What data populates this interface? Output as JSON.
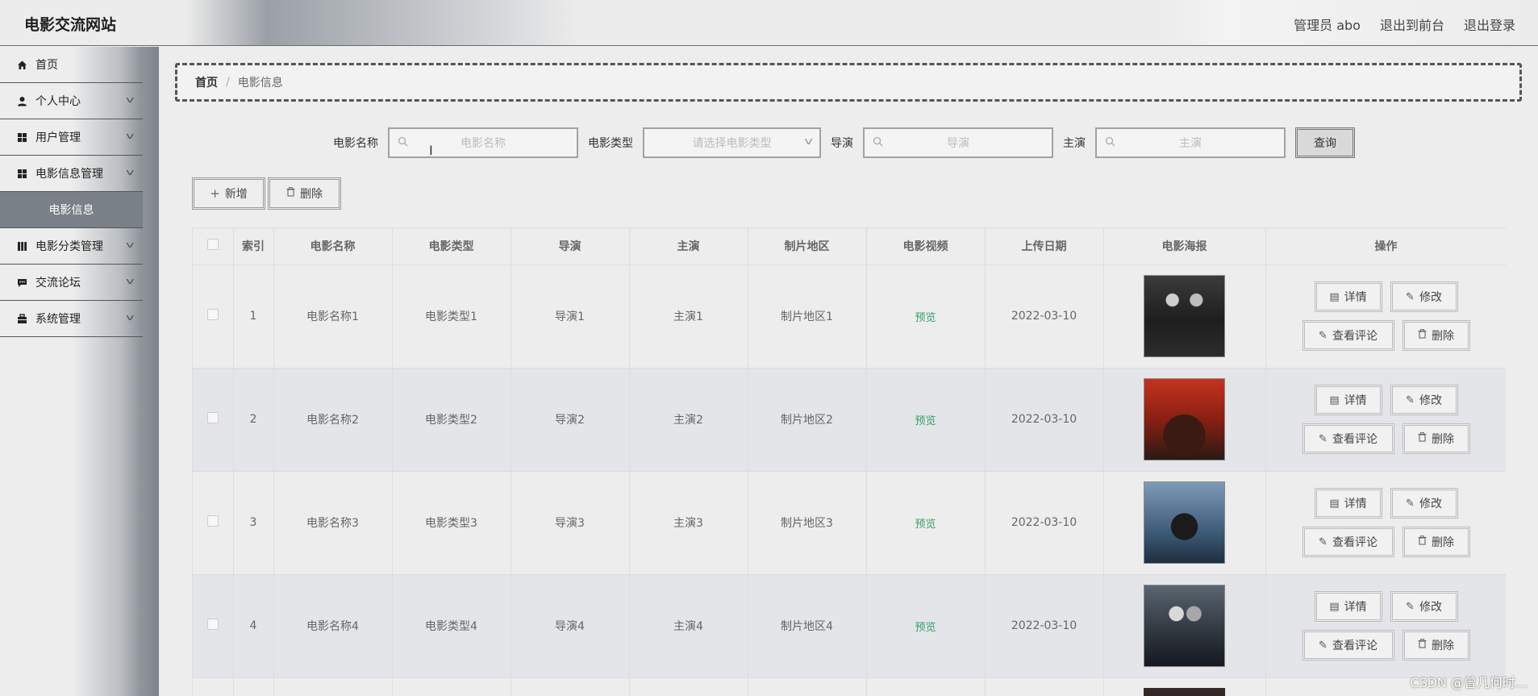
{
  "header": {
    "brand": "电影交流网站",
    "admin": "管理员 abo",
    "to_front": "退出到前台",
    "logout": "退出登录"
  },
  "sidebar": {
    "items": [
      {
        "label": "首页",
        "icon": "home-icon"
      },
      {
        "label": "个人中心",
        "icon": "user-icon"
      },
      {
        "label": "用户管理",
        "icon": "grid-icon"
      },
      {
        "label": "电影信息管理",
        "icon": "grid-icon"
      },
      {
        "label": "电影分类管理",
        "icon": "book-icon"
      },
      {
        "label": "交流论坛",
        "icon": "chat-icon"
      },
      {
        "label": "系统管理",
        "icon": "briefcase-icon"
      }
    ],
    "sub_active": "电影信息"
  },
  "breadcrumb": {
    "home": "首页",
    "sep": "/",
    "current": "电影信息"
  },
  "search": {
    "name_label": "电影名称",
    "name_placeholder": "电影名称",
    "type_label": "电影类型",
    "type_placeholder": "请选择电影类型",
    "director_label": "导演",
    "director_placeholder": "导演",
    "actor_label": "主演",
    "actor_placeholder": "主演",
    "query_label": "查询"
  },
  "actions": {
    "add": "新增",
    "delete": "删除"
  },
  "table": {
    "headers": [
      "索引",
      "电影名称",
      "电影类型",
      "导演",
      "主演",
      "制片地区",
      "电影视频",
      "上传日期",
      "电影海报",
      "操作"
    ],
    "rows": [
      {
        "idx": "1",
        "name": "电影名称1",
        "type": "电影类型1",
        "director": "导演1",
        "actor": "主演1",
        "region": "制片地区1",
        "video": "预览",
        "date": "2022-03-10"
      },
      {
        "idx": "2",
        "name": "电影名称2",
        "type": "电影类型2",
        "director": "导演2",
        "actor": "主演2",
        "region": "制片地区2",
        "video": "预览",
        "date": "2022-03-10"
      },
      {
        "idx": "3",
        "name": "电影名称3",
        "type": "电影类型3",
        "director": "导演3",
        "actor": "主演3",
        "region": "制片地区3",
        "video": "预览",
        "date": "2022-03-10"
      },
      {
        "idx": "4",
        "name": "电影名称4",
        "type": "电影类型4",
        "director": "导演4",
        "actor": "主演4",
        "region": "制片地区4",
        "video": "预览",
        "date": "2022-03-10"
      }
    ],
    "ops": {
      "detail": "详情",
      "edit": "修改",
      "comments": "查看评论",
      "delete": "删除"
    }
  },
  "colors": {
    "accent_preview": "#35a06c",
    "sidebar_active": "#7a8087"
  },
  "watermark": "CSDN @曾几何时…"
}
